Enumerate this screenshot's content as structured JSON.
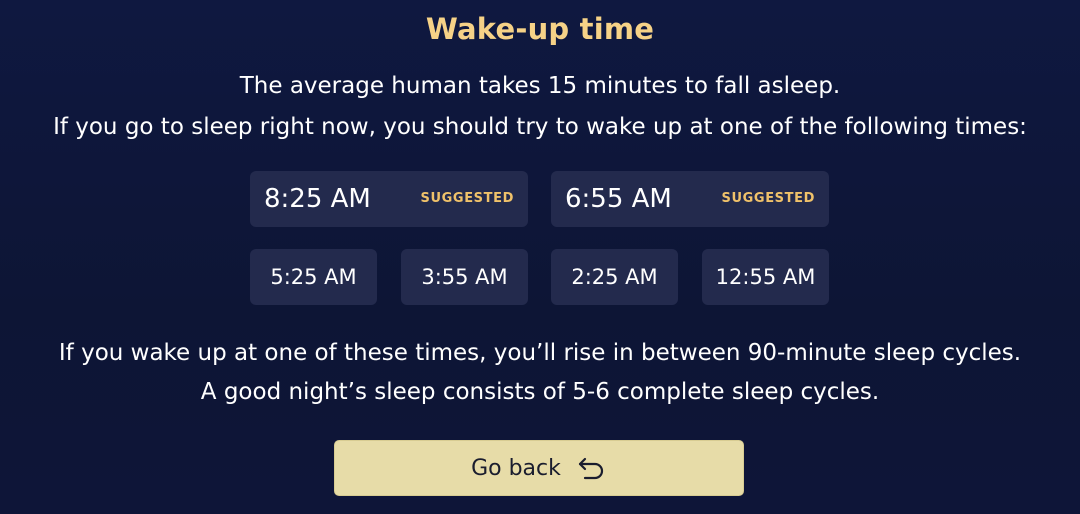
{
  "title": "Wake-up time",
  "intro": {
    "line1": "The average human takes 15 minutes to fall asleep.",
    "line2": "If you go to sleep right now, you should try to wake up at one of the following times:"
  },
  "suggested": [
    {
      "time": "8:25 AM",
      "badge": "SUGGESTED"
    },
    {
      "time": "6:55 AM",
      "badge": "SUGGESTED"
    }
  ],
  "others": [
    {
      "time": "5:25 AM"
    },
    {
      "time": "3:55 AM"
    },
    {
      "time": "2:25 AM"
    },
    {
      "time": "12:55 AM"
    }
  ],
  "outro": {
    "line1": "If you wake up at one of these times, you’ll rise in between 90-minute sleep cycles.",
    "line2": "A good night’s sleep consists of 5-6 complete sleep cycles."
  },
  "back_button": {
    "label": "Go back",
    "icon": "return-arrow-icon"
  },
  "colors": {
    "background": "#0f1840",
    "title": "#f6d287",
    "badge": "#f0c26a",
    "card": "#232a4d",
    "button": "#e7dca8"
  }
}
